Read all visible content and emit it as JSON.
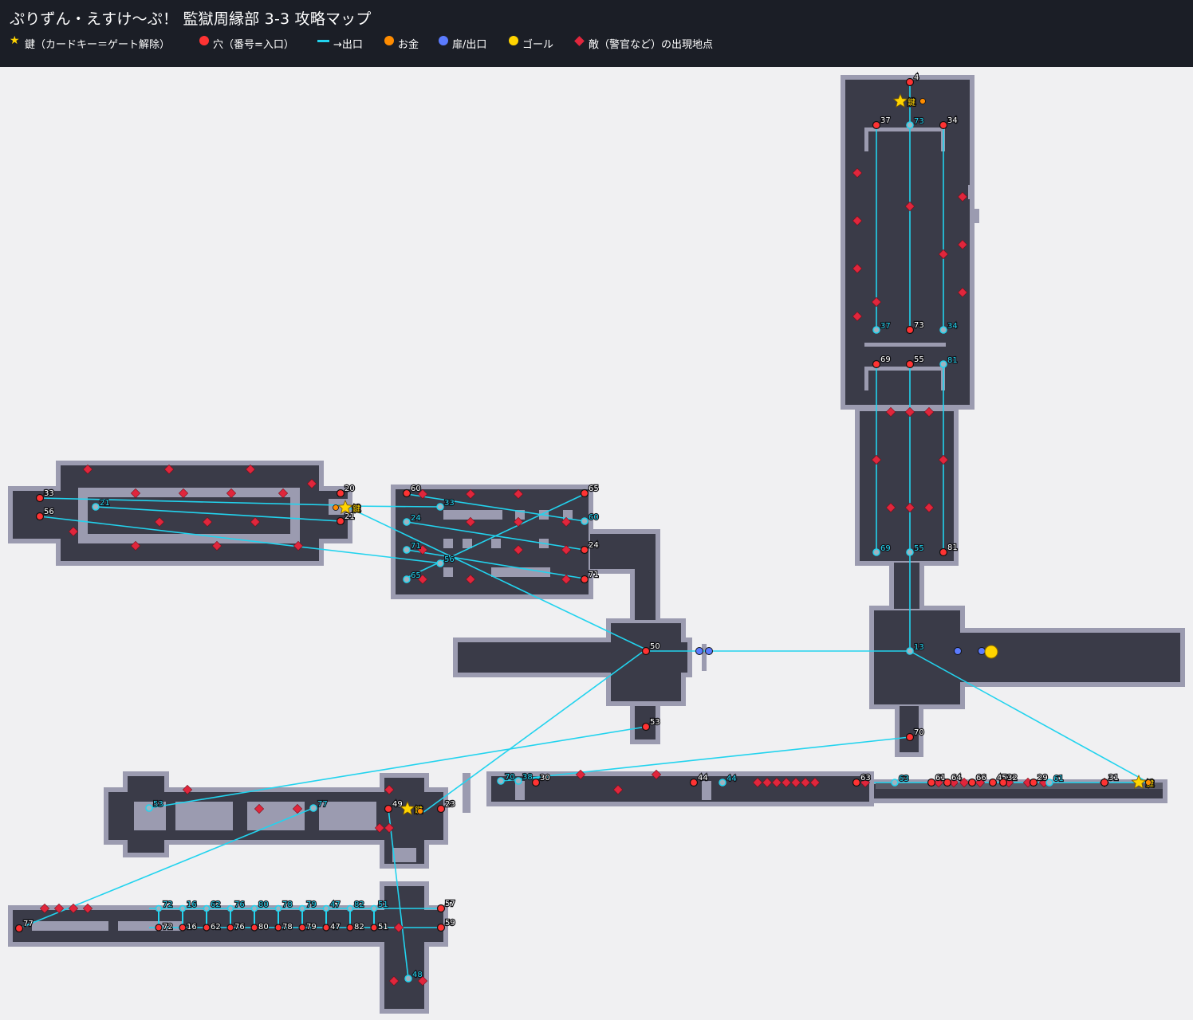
{
  "title": "ぷりずん・えすけ〜ぷ！ 監獄周縁部 3-3 攻略マップ",
  "legend": [
    {
      "icon": "star-icon",
      "label": "鍵（カードキー＝ゲート解除）",
      "color": "#ffd400"
    },
    {
      "icon": "hole-dot-icon",
      "label": "穴（番号=入口）",
      "color": "#ff3333"
    },
    {
      "icon": "exit-line-icon",
      "label": "→出口",
      "color": "#22d3ee"
    },
    {
      "icon": "money-dot-icon",
      "label": "お金",
      "color": "#ff8c00"
    },
    {
      "icon": "door-dot-icon",
      "label": "扉/出口",
      "color": "#5b7bff"
    },
    {
      "icon": "goal-dot-icon",
      "label": "ゴール",
      "color": "#ffd400"
    },
    {
      "icon": "enemy-diamond-icon",
      "label": "敵（警官など）の出現地点",
      "color": "#e0263c"
    }
  ],
  "colors": {
    "floor": "#3a3b48",
    "wall": "#9b9bb0",
    "background": "#f0f0f2",
    "hole": "#ff3333",
    "exit": "#22d3ee",
    "key": "#ffd400",
    "enemy": "#e0263c",
    "door": "#5b7bff"
  },
  "key_label": "鍵",
  "holes": [
    "4",
    "37",
    "34",
    "73",
    "69",
    "55",
    "81",
    "20",
    "21",
    "33",
    "56",
    "60",
    "65",
    "24",
    "71",
    "50",
    "53",
    "70",
    "23",
    "49",
    "57",
    "59",
    "77",
    "72",
    "16",
    "62",
    "76",
    "80",
    "78",
    "79",
    "47",
    "82",
    "51",
    "30",
    "44",
    "63",
    "61",
    "64",
    "66",
    "65",
    "45",
    "32",
    "29",
    "31",
    "13"
  ],
  "exits": [
    "73",
    "37",
    "34",
    "69",
    "55",
    "81",
    "21",
    "60",
    "33",
    "24",
    "71",
    "56",
    "65",
    "13",
    "53",
    "77",
    "48",
    "70",
    "38",
    "44",
    "63",
    "61",
    "72",
    "16",
    "62",
    "76",
    "80",
    "78",
    "79",
    "47",
    "82",
    "51"
  ]
}
